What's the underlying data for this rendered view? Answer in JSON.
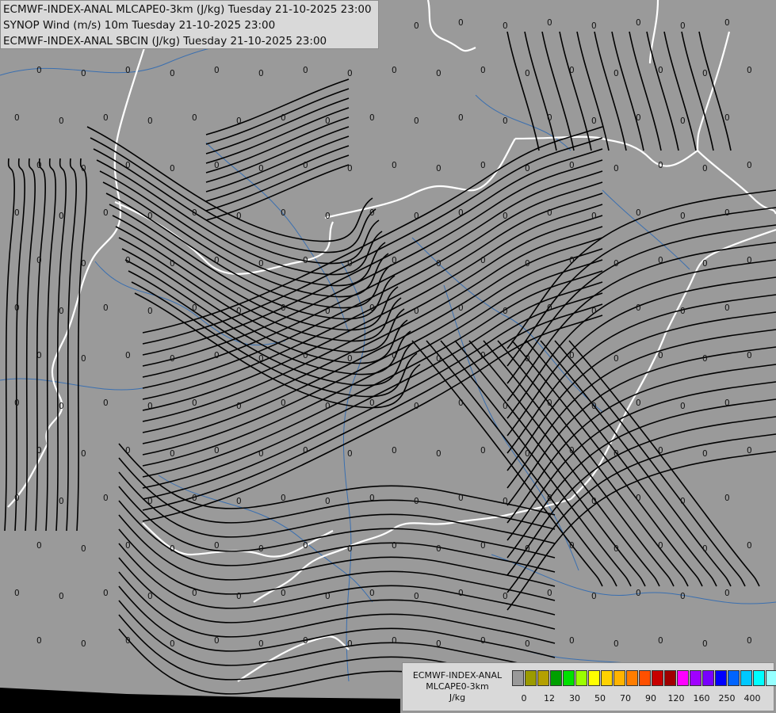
{
  "titles": [
    "ECMWF-INDEX-ANAL MLCAPE0-3km (J/kg) Tuesday 21-10-2025 23:00",
    "SYNOP Wind (m/s) 10m Tuesday 21-10-2025 23:00",
    "ECMWF-INDEX-ANAL SBCIN (J/kg) Tuesday 21-10-2025 23:00"
  ],
  "legend": {
    "line1": "ECMWF-INDEX-ANAL",
    "line2": "MLCAPE0-3km",
    "line3": "J/kg",
    "colors": [
      "#999999",
      "#9b9b00",
      "#b4a000",
      "#00a000",
      "#00e100",
      "#9bff00",
      "#ffff00",
      "#ffd200",
      "#ffb400",
      "#ff7d00",
      "#ff5000",
      "#c80000",
      "#a00000",
      "#ff00ff",
      "#a000ff",
      "#7800ff",
      "#0000ff",
      "#0064ff",
      "#00c8ff",
      "#00ffff",
      "#96ffff",
      "#ffffff"
    ],
    "ticks": [
      "0",
      "12",
      "30",
      "50",
      "70",
      "90",
      "120",
      "160",
      "250",
      "400"
    ]
  },
  "value_label": "0",
  "colors": {
    "background": "#9a9a9a",
    "border": "#ffffff",
    "river": "#3a6fb0",
    "streamline": "#000000",
    "panel": "#d9d9d9"
  }
}
